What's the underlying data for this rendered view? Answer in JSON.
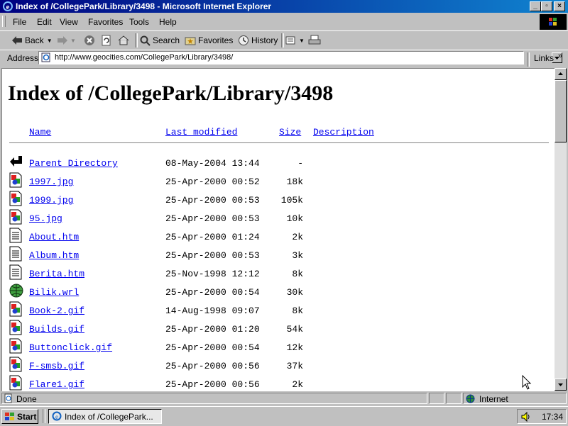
{
  "window": {
    "title": "Index of /CollegePark/Library/3498 - Microsoft Internet Explorer",
    "min_glyph": "_",
    "max_glyph": "▫",
    "close_glyph": "×"
  },
  "menu": [
    "File",
    "Edit",
    "View",
    "Favorites",
    "Tools",
    "Help"
  ],
  "toolbar": {
    "back": "Back",
    "search": "Search",
    "favorites": "Favorites",
    "history": "History"
  },
  "address": {
    "label": "Address",
    "url": "http://www.geocities.com/CollegePark/Library/3498/",
    "links": "Links"
  },
  "page": {
    "title": "Index of /CollegePark/Library/3498",
    "columns": {
      "name": "Name",
      "last_modified": "Last modified",
      "size": "Size",
      "description": "Description"
    },
    "rows": [
      {
        "icon": "back-folder-icon",
        "name": "Parent Directory",
        "modified": "08-May-2004 13:44",
        "size": "-"
      },
      {
        "icon": "image-file-icon",
        "name": "1997.jpg",
        "modified": "25-Apr-2000 00:52",
        "size": "18k"
      },
      {
        "icon": "image-file-icon",
        "name": "1999.jpg",
        "modified": "25-Apr-2000 00:53",
        "size": "105k"
      },
      {
        "icon": "image-file-icon",
        "name": "95.jpg",
        "modified": "25-Apr-2000 00:53",
        "size": "10k"
      },
      {
        "icon": "text-file-icon",
        "name": "About.htm",
        "modified": "25-Apr-2000 01:24",
        "size": "2k"
      },
      {
        "icon": "text-file-icon",
        "name": "Album.htm",
        "modified": "25-Apr-2000 00:53",
        "size": "3k"
      },
      {
        "icon": "text-file-icon",
        "name": "Berita.htm",
        "modified": "25-Nov-1998 12:12",
        "size": "8k"
      },
      {
        "icon": "world-file-icon",
        "name": "Bilik.wrl",
        "modified": "25-Apr-2000 00:54",
        "size": "30k"
      },
      {
        "icon": "image-file-icon",
        "name": "Book-2.gif",
        "modified": "14-Aug-1998 09:07",
        "size": "8k"
      },
      {
        "icon": "image-file-icon",
        "name": "Builds.gif",
        "modified": "25-Apr-2000 01:20",
        "size": "54k"
      },
      {
        "icon": "image-file-icon",
        "name": "Buttonclick.gif",
        "modified": "25-Apr-2000 00:54",
        "size": "12k"
      },
      {
        "icon": "image-file-icon",
        "name": "F-smsb.gif",
        "modified": "25-Apr-2000 00:56",
        "size": "37k"
      },
      {
        "icon": "image-file-icon",
        "name": "Flare1.gif",
        "modified": "25-Apr-2000 00:56",
        "size": "2k"
      }
    ]
  },
  "status": {
    "text": "Done",
    "zone": "Internet"
  },
  "taskbar": {
    "start": "Start",
    "task": "Index of /CollegePark...",
    "clock": "17:34"
  },
  "colors": {
    "title_start": "#000080",
    "title_end": "#1084d0",
    "link": "#0000ee",
    "chrome": "#c0c0c0"
  }
}
